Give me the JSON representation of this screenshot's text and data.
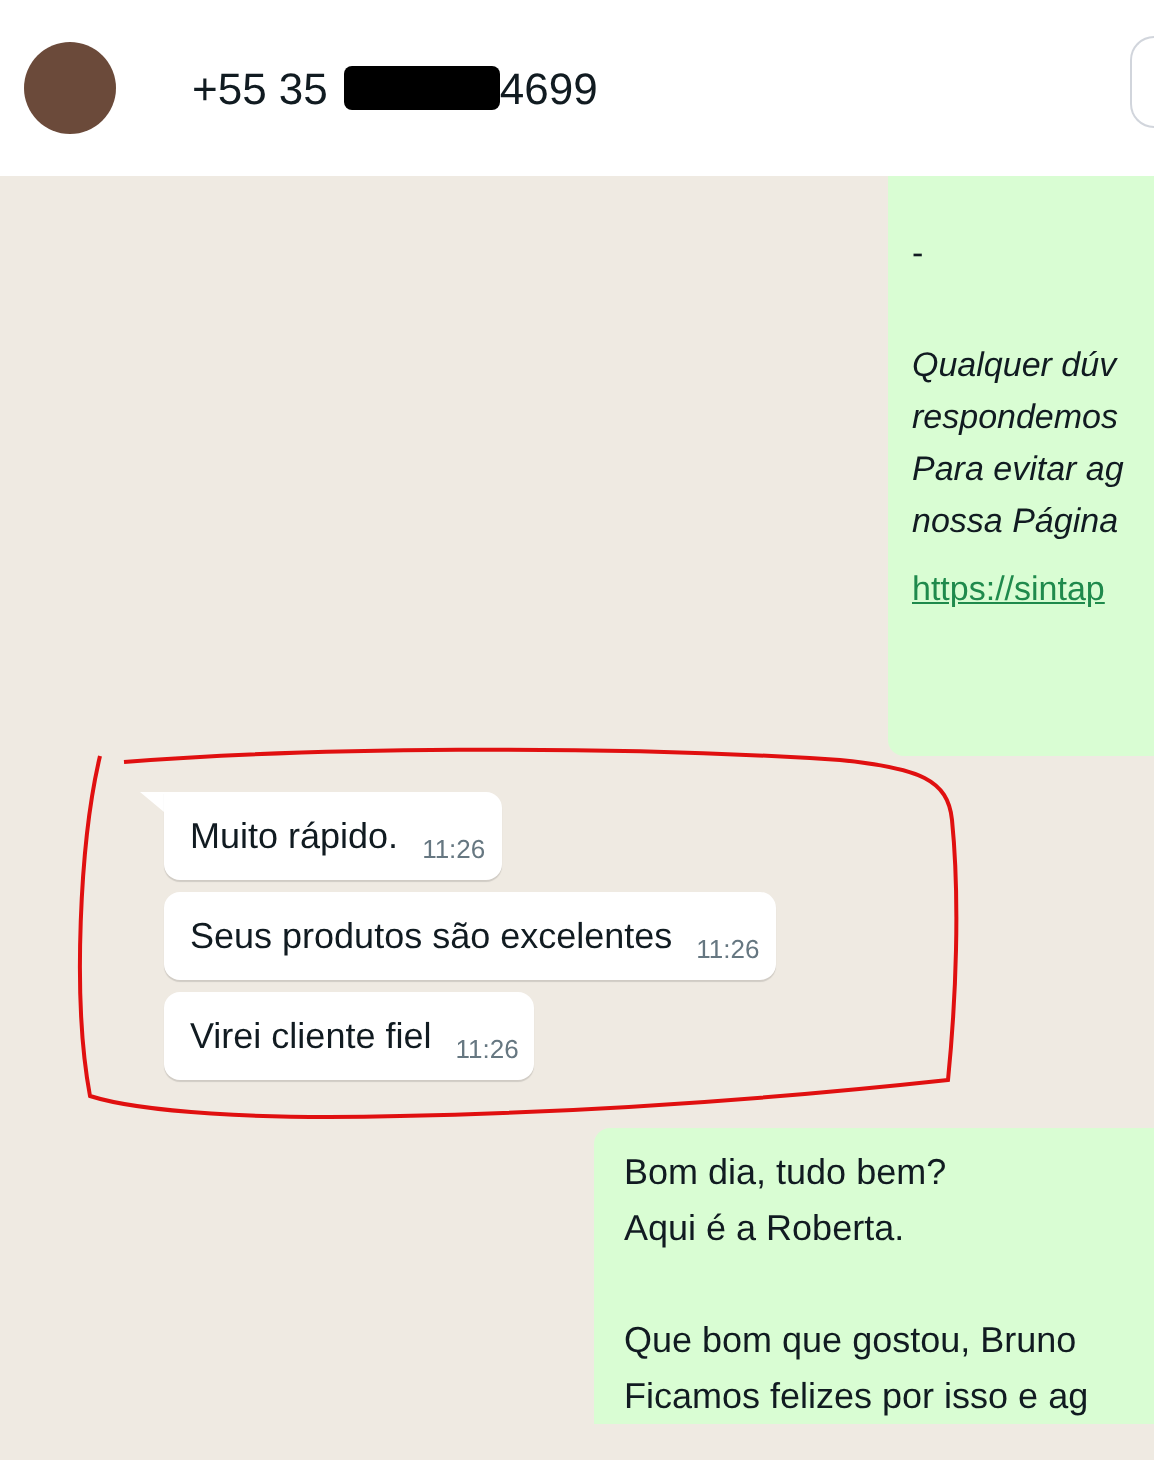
{
  "header": {
    "phone_prefix": "+55 35",
    "phone_suffix": "4699",
    "redacted": true
  },
  "messages": [
    {
      "kind": "outgoing",
      "paragraphs": [
        [
          {
            "text": "-",
            "kind": "plain"
          }
        ],
        [
          {
            "text": "Qualquer dúv",
            "kind": "italic"
          },
          {
            "text": "respondemos",
            "kind": "italic"
          },
          {
            "text": "Para evitar ag",
            "kind": "italic"
          },
          {
            "text": "nossa Página",
            "kind": "italic"
          },
          {
            "text": "https://sintap",
            "kind": "link"
          }
        ]
      ]
    },
    {
      "kind": "incoming",
      "text": "Muito rápido.",
      "time": "11:26",
      "tail": true
    },
    {
      "kind": "incoming",
      "text": "Seus produtos são excelentes",
      "time": "11:26",
      "tail": false
    },
    {
      "kind": "incoming",
      "text": "Virei cliente fiel",
      "time": "11:26",
      "tail": false
    },
    {
      "kind": "outgoing",
      "paragraphs": [
        [
          {
            "text": "Bom dia, tudo bem?",
            "kind": "plain"
          },
          {
            "text": "Aqui é a Roberta.",
            "kind": "plain"
          }
        ],
        [
          {
            "text": "Que bom que gostou, Bruno",
            "kind": "plain"
          },
          {
            "text": "Ficamos felizes por isso e ag",
            "kind": "plain"
          }
        ]
      ]
    }
  ]
}
